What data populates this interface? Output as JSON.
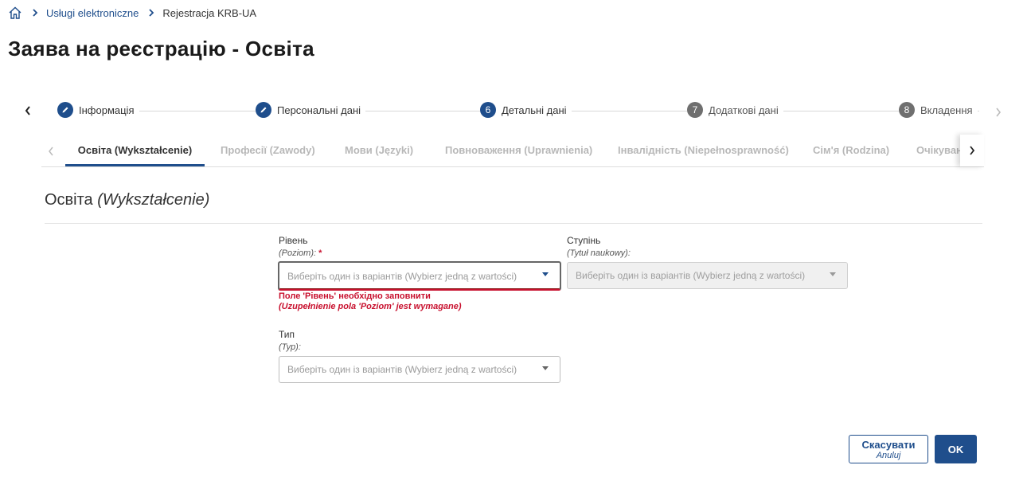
{
  "breadcrumb": {
    "items": [
      "Usługi elektroniczne",
      "Rejestracja KRB-UA"
    ]
  },
  "page_title": "Заява на реєстрацію - Освіта",
  "stepper": {
    "steps": [
      {
        "label": "Інформація",
        "marker": "✎",
        "state": "done"
      },
      {
        "label": "Персональні дані",
        "marker": "✎",
        "state": "done"
      },
      {
        "label": "Детальні дані",
        "marker": "6",
        "state": "current"
      },
      {
        "label": "Додаткові дані",
        "marker": "7",
        "state": "pending"
      },
      {
        "label": "Вкладення",
        "marker": "8",
        "state": "pending"
      }
    ]
  },
  "tabs": [
    {
      "label": "Освіта (Wykształcenie)",
      "active": true
    },
    {
      "label": "Професії (Zawody)"
    },
    {
      "label": "Мови (Języki)"
    },
    {
      "label": "Повноваження (Uprawnienia)"
    },
    {
      "label": "Інвалідність (Niepełnosprawność)"
    },
    {
      "label": "Сім'я (Rodzina)"
    },
    {
      "label": "Очікуван"
    }
  ],
  "section": {
    "title": "Освіта",
    "title_pl": "(Wykształcenie)"
  },
  "form": {
    "level": {
      "label": "Рівень",
      "sub": "(Poziom):",
      "required_mark": "*",
      "placeholder": "Виберіть один із варіантів (Wybierz jedną z wartości)",
      "error_ua": "Поле 'Рівень' необхідно заповнити",
      "error_pl": "(Uzupełnienie pola 'Poziom' jest wymagane)"
    },
    "degree": {
      "label": "Ступінь",
      "sub": "(Tytuł naukowy):",
      "placeholder": "Виберіть один із варіантів (Wybierz jedną z wartości)"
    },
    "type": {
      "label": "Тип",
      "sub": "(Typ):",
      "placeholder": "Виберіть один із варіантів (Wybierz jedną z wartości)"
    }
  },
  "buttons": {
    "cancel": "Скасувати",
    "cancel_pl": "Anuluj",
    "ok": "OK"
  },
  "colors": {
    "primary": "#1f4e8c",
    "error": "#c8102e"
  }
}
